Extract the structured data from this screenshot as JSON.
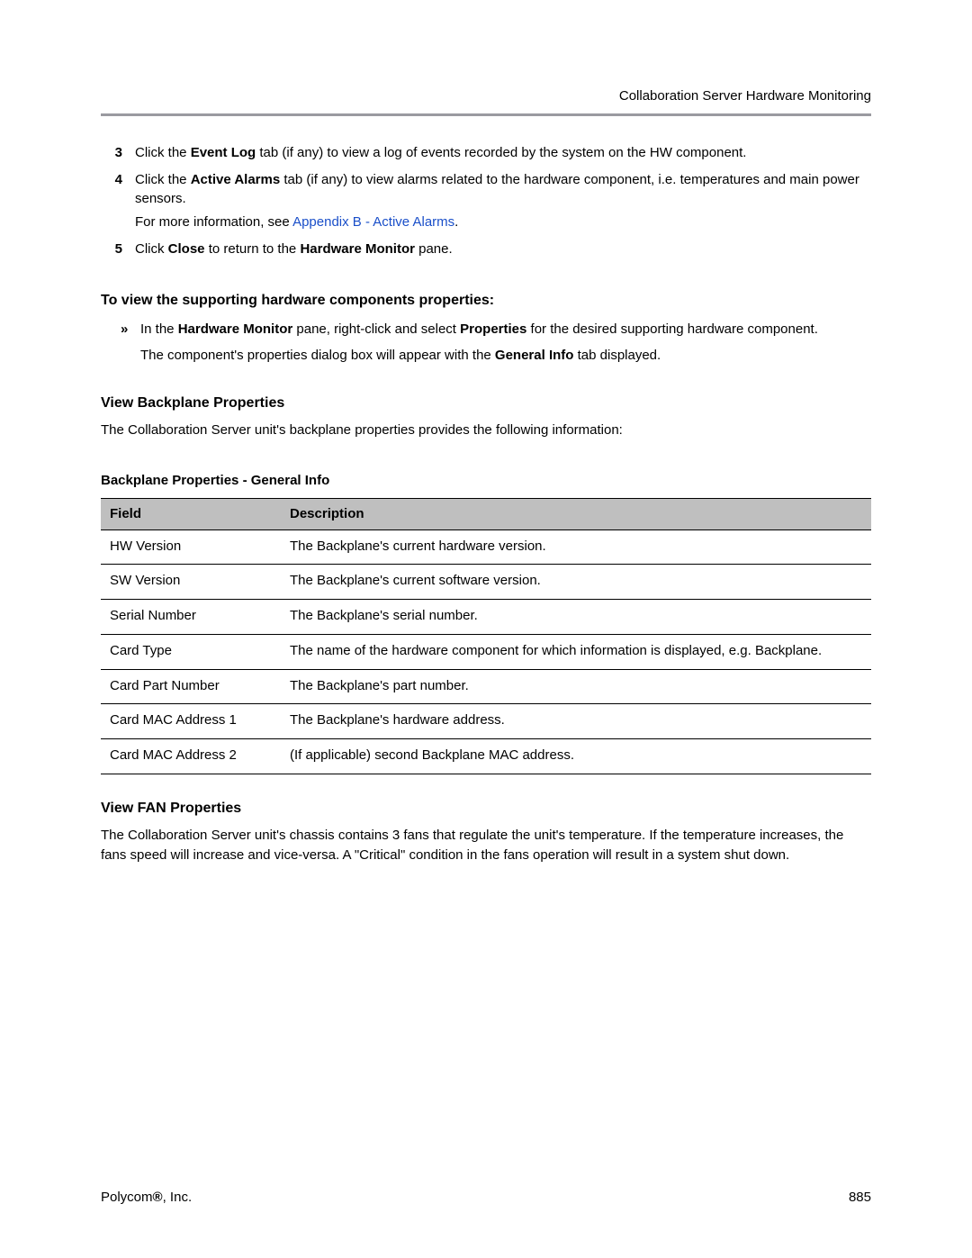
{
  "header": {
    "title": "Collaboration Server Hardware Monitoring"
  },
  "steps": {
    "s3_num": "3",
    "s3_a": "Click the ",
    "s3_b": "Event Log",
    "s3_c": " tab (if any) to view a log of events recorded by the system on the HW component.",
    "s4_num": "4",
    "s4_a": "Click the ",
    "s4_b": "Active Alarms",
    "s4_c": " tab (if any) to view alarms related to the hardware component, i.e. temperatures and main power sensors.",
    "s4_info_a": "For more information, see ",
    "s4_info_link": "Appendix B - Active Alarms",
    "s4_info_b": ".",
    "s5_num": "5",
    "s5_a": "Click ",
    "s5_b": "Close",
    "s5_c": " to return to the ",
    "s5_d": "Hardware Monitor",
    "s5_e": " pane."
  },
  "view_support": {
    "heading": "To view the supporting hardware components properties:",
    "bullet_mark": "»",
    "b_a": "In the ",
    "b_b": "Hardware Monitor",
    "b_c": " pane, right-click and select ",
    "b_d": "Properties",
    "b_e": " for the desired supporting hardware component.",
    "b2_a": "The component's properties dialog box will appear with the ",
    "b2_b": "General Info",
    "b2_c": " tab displayed."
  },
  "backplane": {
    "heading": "View Backplane Properties",
    "intro": "The Collaboration Server unit's backplane properties provides the following information:",
    "caption": "Backplane Properties - General Info",
    "col_field": "Field",
    "col_desc": "Description",
    "rows": [
      {
        "field": "HW Version",
        "desc": "The Backplane's current hardware version."
      },
      {
        "field": "SW Version",
        "desc": "The Backplane's current software version."
      },
      {
        "field": "Serial Number",
        "desc": "The Backplane's serial number."
      },
      {
        "field": "Card Type",
        "desc": "The name of the hardware component for which information is displayed, e.g. Backplane."
      },
      {
        "field": "Card Part Number",
        "desc": "The Backplane's part number."
      },
      {
        "field": "Card MAC Address 1",
        "desc": "The Backplane's hardware address."
      },
      {
        "field": "Card MAC Address 2",
        "desc": "(If applicable) second Backplane MAC address."
      }
    ]
  },
  "fan": {
    "heading": "View FAN Properties",
    "body": "The Collaboration Server unit's chassis contains 3 fans that regulate the unit's temperature. If the temperature increases, the fans speed will increase and vice-versa. A \"Critical\" condition in the fans operation will result in a system shut down."
  },
  "footer": {
    "left_a": "Polycom",
    "left_b": "®",
    "left_c": ", Inc.",
    "right": "885"
  }
}
